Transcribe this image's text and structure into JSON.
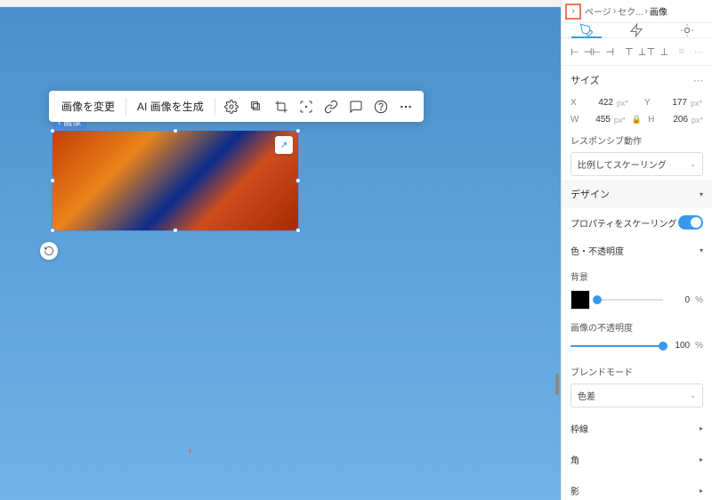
{
  "breadcrumb": {
    "p1": "ページ",
    "p2": "セク...",
    "p3": "画像"
  },
  "toolbar": {
    "change": "画像を変更",
    "aigen": "AI 画像を生成"
  },
  "badge": "画像",
  "panel": {
    "size_title": "サイズ",
    "x_lbl": "X",
    "x": "422",
    "y_lbl": "Y",
    "y": "177",
    "w_lbl": "W",
    "w": "455",
    "h_lbl": "H",
    "h": "206",
    "unit": "px*",
    "unit2": "px*",
    "responsive_title": "レスポンシブ動作",
    "responsive_val": "比例してスケーリング",
    "design_title": "デザイン",
    "scale_prop": "プロパティをスケーリング",
    "color_opacity": "色・不透明度",
    "bg_lbl": "背景",
    "bg_val": "0",
    "bg_unit": "%",
    "img_opacity": "画像の不透明度",
    "op_val": "100",
    "op_unit": "%",
    "blend_title": "ブレンドモード",
    "blend_val": "色差",
    "border": "枠線",
    "corner": "角",
    "shadow": "影"
  }
}
